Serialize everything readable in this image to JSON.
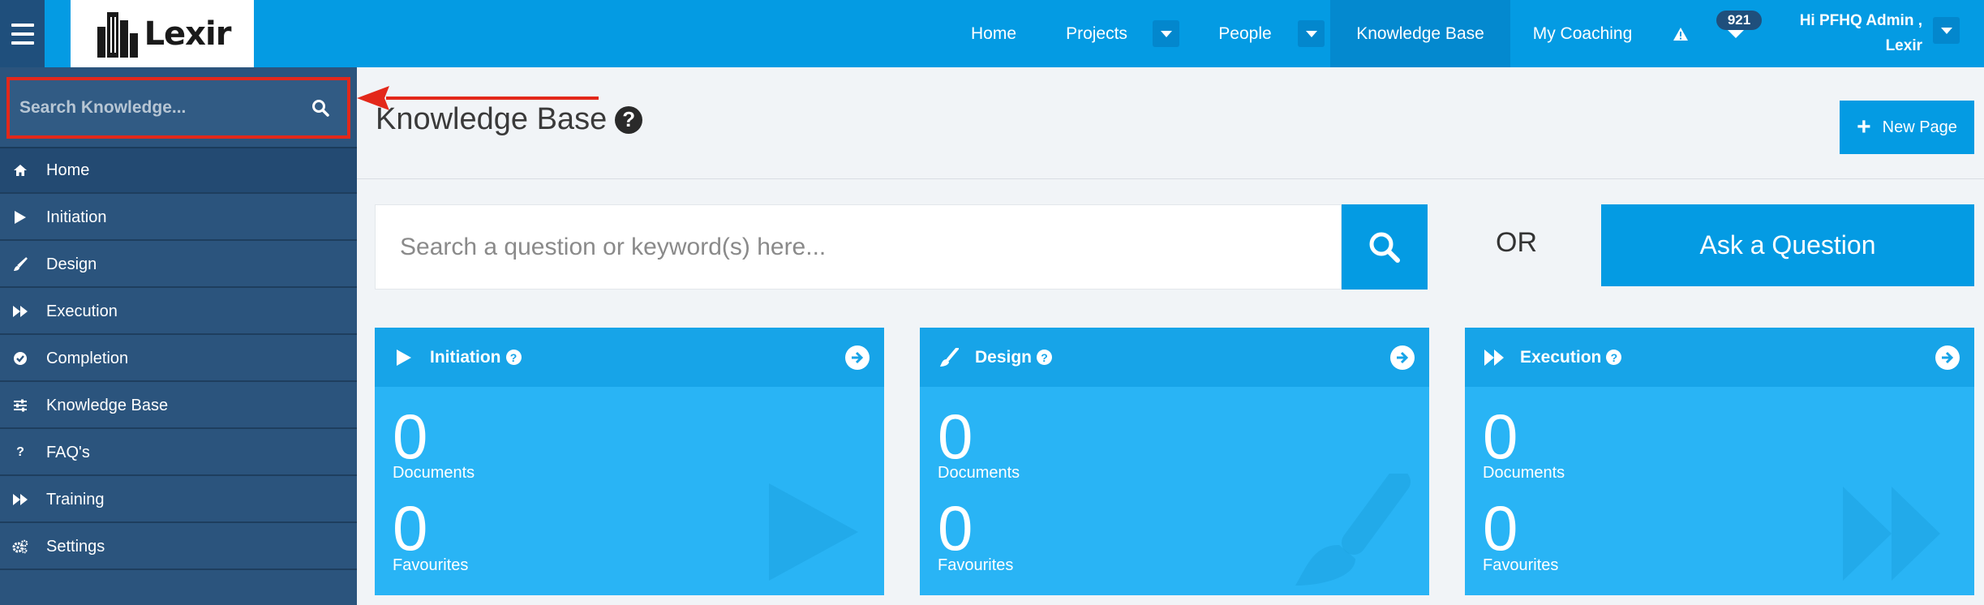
{
  "app": {
    "logo_text": "Lexir"
  },
  "nav": {
    "items": [
      {
        "label": "Home"
      },
      {
        "label": "Projects"
      },
      {
        "label": "People"
      },
      {
        "label": "Knowledge Base"
      },
      {
        "label": "My Coaching"
      }
    ],
    "notification_count": "921",
    "user_greeting_line1": "Hi PFHQ Admin ,",
    "user_greeting_line2": "Lexir"
  },
  "sidebar": {
    "search_placeholder": "Search Knowledge...",
    "items": [
      {
        "label": "Home",
        "icon": "home-icon"
      },
      {
        "label": "Initiation",
        "icon": "play-icon"
      },
      {
        "label": "Design",
        "icon": "brush-icon"
      },
      {
        "label": "Execution",
        "icon": "fast-forward-icon"
      },
      {
        "label": "Completion",
        "icon": "check-circle-icon"
      },
      {
        "label": "Knowledge Base",
        "icon": "sliders-icon"
      },
      {
        "label": "FAQ's",
        "icon": "question-icon"
      },
      {
        "label": "Training",
        "icon": "fast-forward-icon"
      },
      {
        "label": "Settings",
        "icon": "gears-icon"
      }
    ]
  },
  "main": {
    "title": "Knowledge Base",
    "new_page_label": "New Page",
    "search_placeholder": "Search a question or keyword(s) here...",
    "or_label": "OR",
    "ask_label": "Ask a Question",
    "cards": [
      {
        "title": "Initiation",
        "documents": "0",
        "documents_label": "Documents",
        "favourites": "0",
        "favourites_label": "Favourites",
        "icon": "play-icon"
      },
      {
        "title": "Design",
        "documents": "0",
        "documents_label": "Documents",
        "favourites": "0",
        "favourites_label": "Favourites",
        "icon": "brush-icon"
      },
      {
        "title": "Execution",
        "documents": "0",
        "documents_label": "Documents",
        "favourites": "0",
        "favourites_label": "Favourites",
        "icon": "fast-forward-icon"
      }
    ]
  },
  "colors": {
    "topbar": "#049be3",
    "sidebar": "#2b547d",
    "card": "#29b4f5",
    "card_header": "#17a4e8",
    "annotation": "#e3281a"
  }
}
